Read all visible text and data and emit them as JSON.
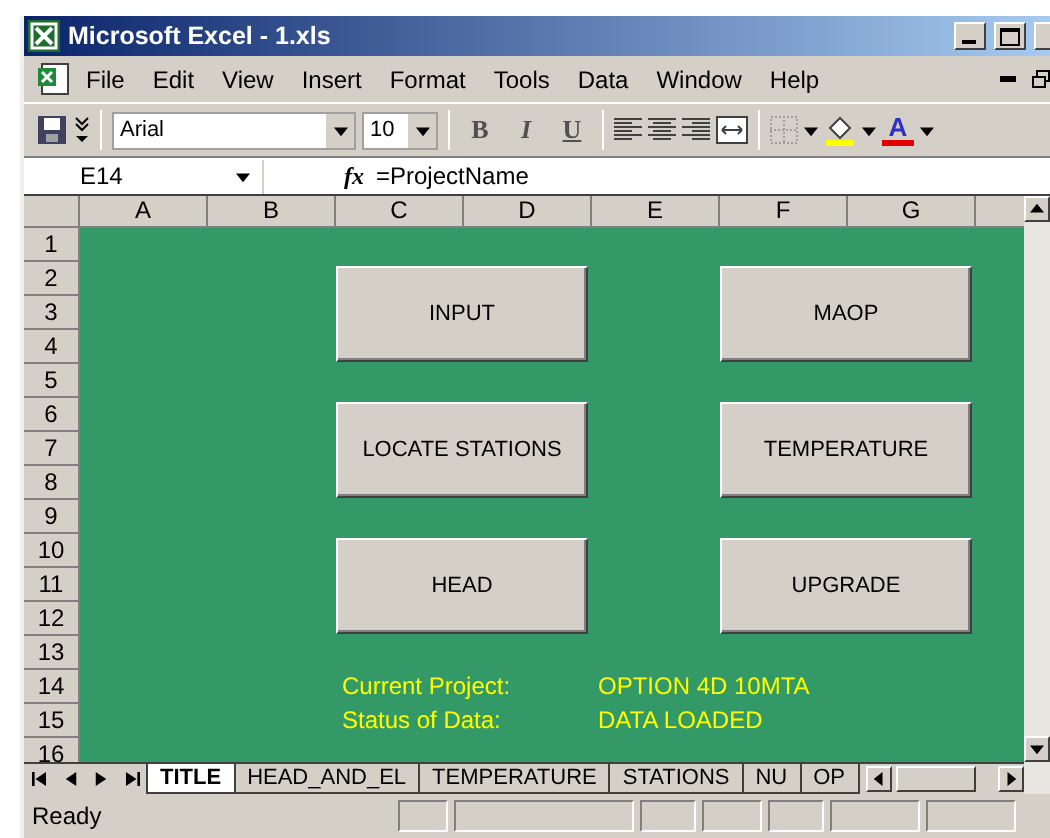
{
  "window": {
    "title": "Microsoft Excel - 1.xls"
  },
  "menu": [
    "File",
    "Edit",
    "View",
    "Insert",
    "Format",
    "Tools",
    "Data",
    "Window",
    "Help"
  ],
  "toolbar": {
    "font": "Arial",
    "size": "10",
    "bold": "B",
    "italic": "I",
    "underline": "U",
    "font_color": "A"
  },
  "formula_bar": {
    "name_box": "E14",
    "fx": "fx",
    "formula": "=ProjectName"
  },
  "columns": [
    "A",
    "B",
    "C",
    "D",
    "E",
    "F",
    "G"
  ],
  "rows": [
    "1",
    "2",
    "3",
    "4",
    "5",
    "6",
    "7",
    "8",
    "9",
    "10",
    "11",
    "12",
    "13",
    "14",
    "15",
    "16"
  ],
  "buttons": [
    {
      "label": "INPUT"
    },
    {
      "label": "MAOP"
    },
    {
      "label": "LOCATE STATIONS"
    },
    {
      "label": "TEMPERATURE"
    },
    {
      "label": "HEAD"
    },
    {
      "label": "UPGRADE"
    }
  ],
  "info": [
    {
      "label": "Current Project:",
      "value": "OPTION 4D 10MTA"
    },
    {
      "label": "Status of Data:",
      "value": "DATA LOADED"
    }
  ],
  "sheet_tabs": [
    {
      "label": "TITLE",
      "selected": true
    },
    {
      "label": "HEAD_AND_EL",
      "selected": false
    },
    {
      "label": "TEMPERATURE",
      "selected": false
    },
    {
      "label": "STATIONS",
      "selected": false
    },
    {
      "label": "NU",
      "selected": false
    },
    {
      "label": "OP",
      "selected": false
    }
  ],
  "status_bar": "Ready"
}
